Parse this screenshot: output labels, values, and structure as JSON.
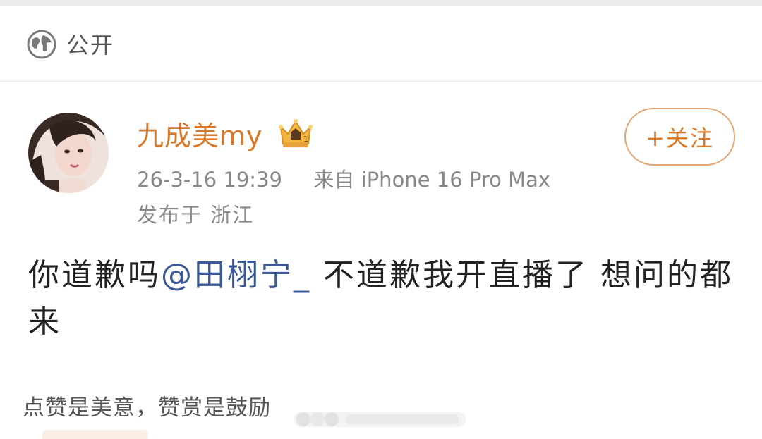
{
  "visibility": {
    "icon": "globe-icon",
    "label": "公开"
  },
  "post": {
    "author": {
      "name": "九成美my",
      "badge_icon": "crown-vip-icon",
      "avatar_icon": "user-avatar"
    },
    "follow_button": "+关注",
    "timestamp": "26-3-16 19:39",
    "source": "来自 iPhone 16 Pro Max",
    "location": "发布于 浙江",
    "content": {
      "before_mention": "你道歉吗",
      "mention": "@田栩宁_",
      "after_mention": " 不道歉我开直播了 想问的都来"
    }
  },
  "reward": {
    "label": "点赞是美意，赞赏是鼓励"
  },
  "colors": {
    "accent": "#d97a2b",
    "mention": "#3b5998",
    "meta_text": "#888888"
  }
}
